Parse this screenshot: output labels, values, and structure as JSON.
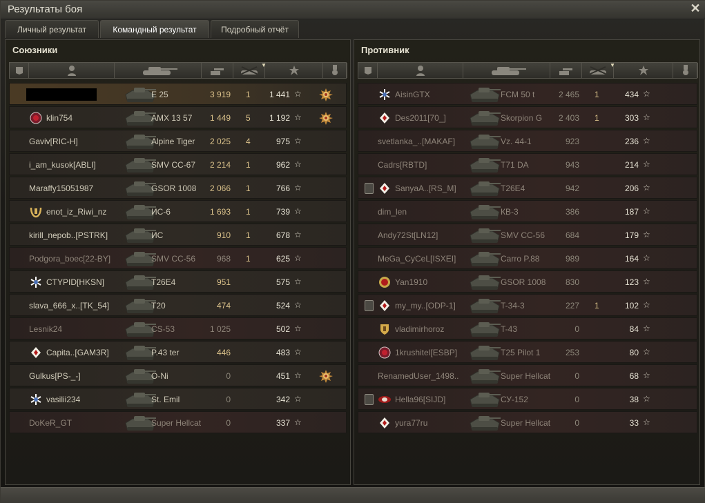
{
  "window": {
    "title": "Результаты боя"
  },
  "tabs": [
    {
      "label": "Личный результат",
      "active": false
    },
    {
      "label": "Командный результат",
      "active": true
    },
    {
      "label": "Подробный отчёт",
      "active": false
    }
  ],
  "allies": {
    "title": "Союзники",
    "rows": [
      {
        "name": "",
        "redacted": true,
        "clan_icon": "",
        "squad": false,
        "tank": "E 25",
        "dmg": "3 919",
        "kills": "1",
        "xp": "1 441",
        "medal": true,
        "state": "player"
      },
      {
        "name": "klin754",
        "clan_icon": "red-emblem",
        "squad": false,
        "tank": "AMX 13 57",
        "dmg": "1 449",
        "kills": "5",
        "xp": "1 192",
        "medal": true,
        "state": "alive"
      },
      {
        "name": "Gaviv[RIC-H]",
        "clan_icon": "",
        "squad": false,
        "tank": "Alpine Tiger",
        "dmg": "2 025",
        "kills": "4",
        "xp": "975",
        "medal": false,
        "state": "alive"
      },
      {
        "name": "i_am_kusok[ABLI]",
        "clan_icon": "",
        "squad": false,
        "tank": "SMV CC-67",
        "dmg": "2 214",
        "kills": "1",
        "xp": "962",
        "medal": false,
        "state": "alive"
      },
      {
        "name": "Maraffy15051987",
        "clan_icon": "",
        "squad": false,
        "tank": "GSOR 1008",
        "dmg": "2 066",
        "kills": "1",
        "xp": "766",
        "medal": false,
        "state": "alive"
      },
      {
        "name": "enot_iz_Riwi_nz",
        "clan_icon": "gold-wreath",
        "squad": false,
        "tank": "ИС-6",
        "dmg": "1 693",
        "kills": "1",
        "xp": "739",
        "medal": false,
        "state": "alive"
      },
      {
        "name": "kirill_nepob..[PSTRK]",
        "clan_icon": "",
        "squad": false,
        "tank": "ИС",
        "dmg": "910",
        "kills": "1",
        "xp": "678",
        "medal": false,
        "state": "alive"
      },
      {
        "name": "Podgora_boec[22-BY]",
        "clan_icon": "",
        "squad": false,
        "tank": "SMV CC-56",
        "dmg": "968",
        "kills": "1",
        "xp": "625",
        "medal": false,
        "state": "dead"
      },
      {
        "name": "CTYPID[HKSN]",
        "clan_icon": "snowflake",
        "squad": false,
        "tank": "T26E4",
        "dmg": "951",
        "kills": "",
        "xp": "575",
        "medal": false,
        "state": "alive"
      },
      {
        "name": "slava_666_x..[TK_54]",
        "clan_icon": "",
        "squad": false,
        "tank": "T20",
        "dmg": "474",
        "kills": "",
        "xp": "524",
        "medal": false,
        "state": "alive"
      },
      {
        "name": "Lesnik24",
        "clan_icon": "",
        "squad": false,
        "tank": "CS-53",
        "dmg": "1 025",
        "kills": "",
        "xp": "502",
        "medal": false,
        "state": "dead"
      },
      {
        "name": "Capita..[GAM3R]",
        "clan_icon": "red-diamond",
        "squad": false,
        "tank": "P.43 ter",
        "dmg": "446",
        "kills": "",
        "xp": "483",
        "medal": false,
        "state": "alive"
      },
      {
        "name": "Gulkus[PS-_-]",
        "clan_icon": "",
        "squad": false,
        "tank": "O-Ni",
        "dmg": "0",
        "kills": "",
        "xp": "451",
        "medal": true,
        "state": "alive"
      },
      {
        "name": "vasilii234",
        "clan_icon": "snowflake",
        "squad": false,
        "tank": "St. Emil",
        "dmg": "0",
        "kills": "",
        "xp": "342",
        "medal": false,
        "state": "alive"
      },
      {
        "name": "DoKeR_GT",
        "clan_icon": "",
        "squad": false,
        "tank": "Super Hellcat",
        "dmg": "0",
        "kills": "",
        "xp": "337",
        "medal": false,
        "state": "dead"
      }
    ]
  },
  "enemies": {
    "title": "Противник",
    "rows": [
      {
        "name": "AisinGTX",
        "clan_icon": "snowflake",
        "squad": false,
        "tank": "FCM 50 t",
        "dmg": "2 465",
        "kills": "1",
        "xp": "434",
        "medal": false,
        "state": "dead"
      },
      {
        "name": "Des2011[70_]",
        "clan_icon": "red-diamond",
        "squad": false,
        "tank": "Skorpion G",
        "dmg": "2 403",
        "kills": "1",
        "xp": "303",
        "medal": false,
        "state": "dead"
      },
      {
        "name": "svetlanka_..[MAKAF]",
        "clan_icon": "",
        "squad": false,
        "tank": "Vz. 44-1",
        "dmg": "923",
        "kills": "",
        "xp": "236",
        "medal": false,
        "state": "dead"
      },
      {
        "name": "Cadrs[RBTD]",
        "clan_icon": "",
        "squad": false,
        "tank": "T71 DA",
        "dmg": "943",
        "kills": "",
        "xp": "214",
        "medal": false,
        "state": "dead"
      },
      {
        "name": "SanyaA..[RS_M]",
        "clan_icon": "red-diamond",
        "squad": true,
        "tank": "T26E4",
        "dmg": "942",
        "kills": "",
        "xp": "206",
        "medal": false,
        "state": "dead"
      },
      {
        "name": "dim_len",
        "clan_icon": "",
        "squad": false,
        "tank": "КВ-3",
        "dmg": "386",
        "kills": "",
        "xp": "187",
        "medal": false,
        "state": "dead"
      },
      {
        "name": "Andy72St[LN12]",
        "clan_icon": "",
        "squad": false,
        "tank": "SMV CC-56",
        "dmg": "684",
        "kills": "",
        "xp": "179",
        "medal": false,
        "state": "dead"
      },
      {
        "name": "MeGa_CyCeL[ISXEI]",
        "clan_icon": "",
        "squad": false,
        "tank": "Carro P.88",
        "dmg": "989",
        "kills": "",
        "xp": "164",
        "medal": false,
        "state": "dead"
      },
      {
        "name": "Yan1910",
        "clan_icon": "red-circle",
        "squad": false,
        "tank": "GSOR 1008",
        "dmg": "830",
        "kills": "",
        "xp": "123",
        "medal": false,
        "state": "dead"
      },
      {
        "name": "my_my..[ODP-1]",
        "clan_icon": "red-diamond",
        "squad": true,
        "tank": "T-34-3",
        "dmg": "227",
        "kills": "1",
        "xp": "102",
        "medal": false,
        "state": "dead"
      },
      {
        "name": "vladimirhoroz",
        "clan_icon": "gold-shield",
        "squad": false,
        "tank": "T-43",
        "dmg": "0",
        "kills": "",
        "xp": "84",
        "medal": false,
        "state": "dead"
      },
      {
        "name": "1krushitel[ESBP]",
        "clan_icon": "red-emblem",
        "squad": false,
        "tank": "T25 Pilot 1",
        "dmg": "253",
        "kills": "",
        "xp": "80",
        "medal": false,
        "state": "dead"
      },
      {
        "name": "RenamedUser_1498..",
        "clan_icon": "",
        "squad": false,
        "tank": "Super Hellcat",
        "dmg": "0",
        "kills": "",
        "xp": "68",
        "medal": false,
        "state": "dead"
      },
      {
        "name": "Hella96[SIJD]",
        "clan_icon": "red-wings",
        "squad": true,
        "tank": "СУ-152",
        "dmg": "0",
        "kills": "",
        "xp": "38",
        "medal": false,
        "state": "dead"
      },
      {
        "name": "yura77ru",
        "clan_icon": "red-diamond",
        "squad": false,
        "tank": "Super Hellcat",
        "dmg": "0",
        "kills": "",
        "xp": "33",
        "medal": false,
        "state": "dead"
      }
    ]
  }
}
